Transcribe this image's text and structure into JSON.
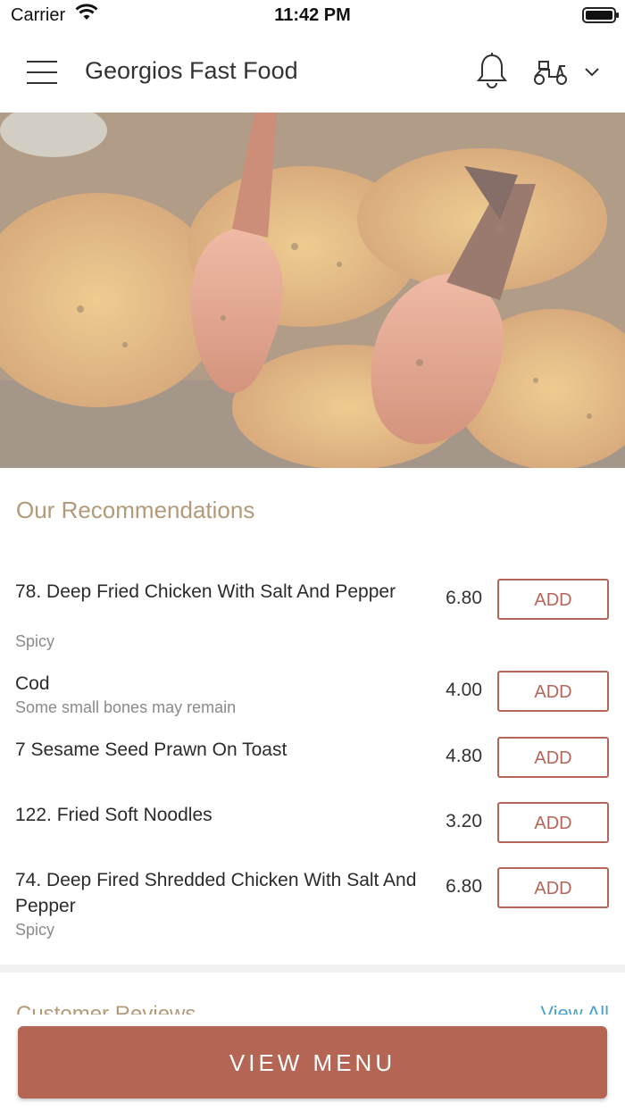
{
  "status_bar": {
    "carrier": "Carrier",
    "time": "11:42 PM"
  },
  "header": {
    "title": "Georgios Fast Food"
  },
  "icons": [
    "menu-icon",
    "bell-icon",
    "delivery-scooter-icon",
    "chevron-down-icon",
    "wifi-icon",
    "battery-icon"
  ],
  "colors": {
    "accent": "#b46554",
    "section_title": "#b39a79",
    "link": "#4aa3c8"
  },
  "recommendations": {
    "title": "Our Recommendations",
    "items": [
      {
        "name": "78. Deep Fried Chicken With Salt And Pepper",
        "description": "Spicy",
        "price": "6.80",
        "button": "ADD"
      },
      {
        "name": "Cod",
        "description": "Some small bones may remain",
        "price": "4.00",
        "button": "ADD"
      },
      {
        "name": "7 Sesame Seed Prawn On Toast",
        "description": "",
        "price": "4.80",
        "button": "ADD"
      },
      {
        "name": "122. Fried Soft Noodles",
        "description": "",
        "price": "3.20",
        "button": "ADD"
      },
      {
        "name": "74. Deep Fired Shredded Chicken With Salt And Pepper",
        "description": "Spicy",
        "price": "6.80",
        "button": "ADD"
      }
    ]
  },
  "reviews": {
    "title": "Customer Reviews",
    "view_all": "View All"
  },
  "footer": {
    "view_menu": "VIEW MENU"
  }
}
